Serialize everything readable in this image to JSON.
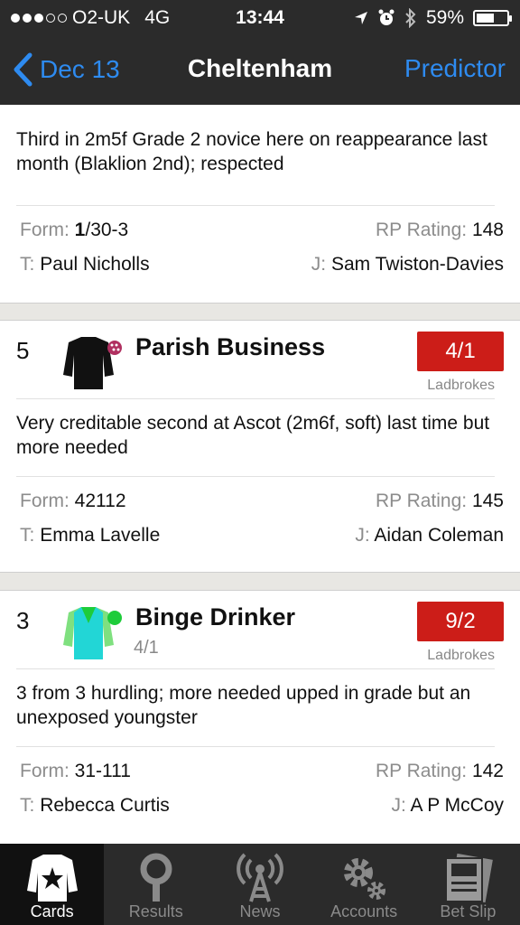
{
  "status_bar": {
    "carrier": "O2-UK",
    "network": "4G",
    "time": "13:44",
    "battery": "59%",
    "battery_level": 0.59
  },
  "nav": {
    "back_label": "Dec 13",
    "title": "Cheltenham",
    "right_label": "Predictor"
  },
  "cards": [
    {
      "comment": "Third in 2m5f Grade 2 novice here on reappearance last month (Blaklion 2nd); respected",
      "form_label": "Form:",
      "form_bold": "1",
      "form_rest": "/30-3",
      "rp_label": "RP Rating:",
      "rp_value": "148",
      "trainer_label": "T:",
      "trainer": "Paul Nicholls",
      "jockey_label": "J:",
      "jockey": "Sam Twiston-Davies"
    },
    {
      "number": "5",
      "name": "Parish Business",
      "odds": "4/1",
      "bookie": "Ladbrokes",
      "comment": "Very creditable second at Ascot (2m6f, soft) last time but more needed",
      "form_label": "Form:",
      "form": "42112",
      "rp_label": "RP Rating:",
      "rp_value": "145",
      "trainer_label": "T:",
      "trainer": "Emma Lavelle",
      "jockey_label": "J:",
      "jockey": "Aidan Coleman",
      "silk_colors": {
        "body": "#111111",
        "cap": "#b03060"
      }
    },
    {
      "number": "3",
      "name": "Binge Drinker",
      "sub": "4/1",
      "odds": "9/2",
      "bookie": "Ladbrokes",
      "comment": "3 from 3 hurdling; more needed upped in grade but an unexposed youngster",
      "form_label": "Form:",
      "form": "31-111",
      "rp_label": "RP Rating:",
      "rp_value": "142",
      "trainer_label": "T:",
      "trainer": "Rebecca Curtis",
      "jockey_label": "J:",
      "jockey": "A P McCoy",
      "silk_colors": {
        "body": "#22d6d6",
        "sleeves": "#7fe07f",
        "cap": "#1ecc3a"
      }
    }
  ],
  "tabs": [
    {
      "label": "Cards",
      "icon": "silks-icon",
      "active": true
    },
    {
      "label": "Results",
      "icon": "results-icon",
      "active": false
    },
    {
      "label": "News",
      "icon": "news-antenna-icon",
      "active": false
    },
    {
      "label": "Accounts",
      "icon": "gear-icon",
      "active": false
    },
    {
      "label": "Bet Slip",
      "icon": "bet-slip-icon",
      "active": false
    }
  ],
  "colors": {
    "accent": "#2e8bf0",
    "odds": "#cc1d18",
    "bar": "#2b2b2b"
  }
}
